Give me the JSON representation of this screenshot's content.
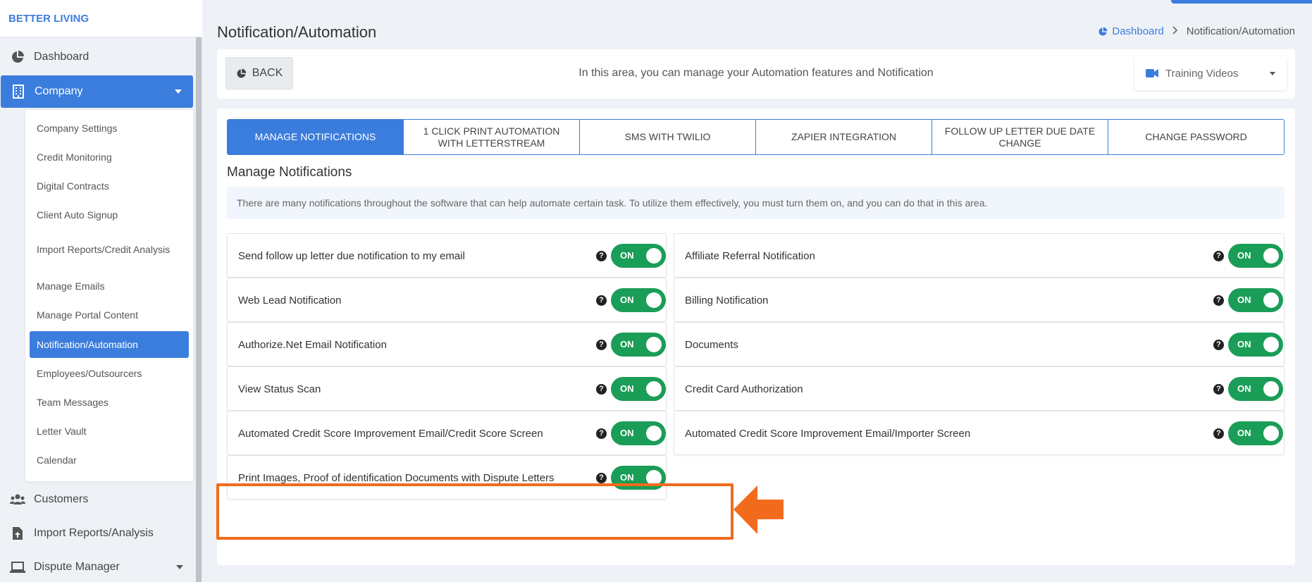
{
  "brand": "BETTER LIVING",
  "sidebar": {
    "items": [
      {
        "label": "Dashboard",
        "icon": "pie-chart-icon"
      },
      {
        "label": "Company",
        "icon": "building-icon"
      },
      {
        "label": "Customers",
        "icon": "users-icon"
      },
      {
        "label": "Import Reports/Analysis",
        "icon": "file-upload-icon"
      },
      {
        "label": "Dispute Manager",
        "icon": "laptop-icon"
      }
    ],
    "company_submenu": [
      "Company Settings",
      "Credit Monitoring",
      "Digital Contracts",
      "Client Auto Signup",
      "Import Reports/Credit Analysis",
      "Manage Emails",
      "Manage Portal Content",
      "Notification/Automation",
      "Employees/Outsourcers",
      "Team Messages",
      "Letter Vault",
      "Calendar"
    ],
    "active_submenu": "Notification/Automation"
  },
  "page": {
    "title": "Notification/Automation",
    "breadcrumb": {
      "home": "Dashboard",
      "current": "Notification/Automation"
    }
  },
  "header": {
    "back_label": "BACK",
    "info": "In this area, you can manage your Automation features and Notification",
    "training_label": "Training Videos"
  },
  "tabs": [
    "MANAGE NOTIFICATIONS",
    "1 CLICK PRINT AUTOMATION WITH LETTERSTREAM",
    "SMS WITH TWILIO",
    "ZAPIER INTEGRATION",
    "FOLLOW UP LETTER DUE DATE CHANGE",
    "CHANGE PASSWORD"
  ],
  "active_tab": "MANAGE NOTIFICATIONS",
  "section": {
    "title": "Manage Notifications",
    "info": "There are many notifications throughout the software that can help automate certain task. To utilize them effectively, you must turn them on, and you can do that in this area."
  },
  "help_glyph": "?",
  "notifications": {
    "left": [
      {
        "label": "Send follow up letter due notification to my email",
        "state": "ON"
      },
      {
        "label": "Web Lead Notification",
        "state": "ON"
      },
      {
        "label": "Authorize.Net Email Notification",
        "state": "ON"
      },
      {
        "label": "View Status Scan",
        "state": "ON"
      },
      {
        "label": "Automated Credit Score Improvement Email/Credit Score Screen",
        "state": "ON"
      },
      {
        "label": "Print Images, Proof of identification Documents with Dispute Letters",
        "state": "ON"
      }
    ],
    "right": [
      {
        "label": "Affiliate Referral Notification",
        "state": "ON"
      },
      {
        "label": "Billing Notification",
        "state": "ON"
      },
      {
        "label": "Documents",
        "state": "ON"
      },
      {
        "label": "Credit Card Authorization",
        "state": "ON"
      },
      {
        "label": "Automated Credit Score Improvement Email/Importer Screen",
        "state": "ON"
      }
    ]
  },
  "colors": {
    "primary": "#3b7ddd",
    "toggle_on": "#1a9d57",
    "highlight": "#f26b1d"
  }
}
